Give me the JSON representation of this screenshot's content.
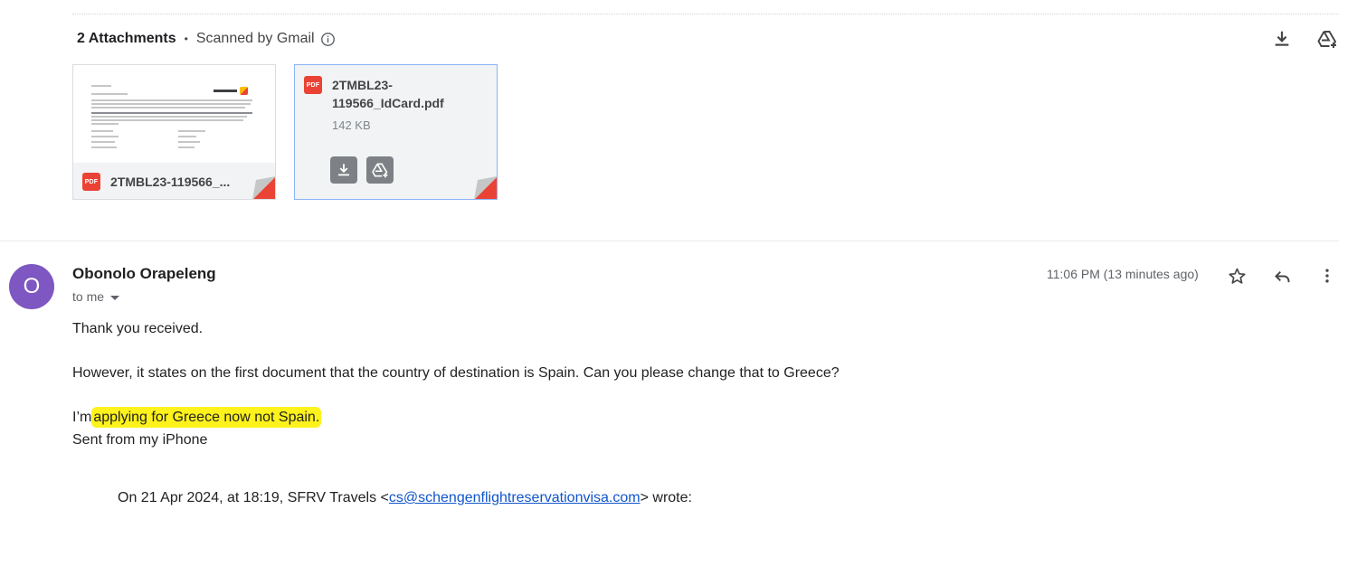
{
  "attachments": {
    "count_label": "2 Attachments",
    "separator": "•",
    "scanned_label": "Scanned by Gmail",
    "files": [
      {
        "name": "2TMBL23-119566_...",
        "type_badge": "PDF"
      },
      {
        "name": "2TMBL23-119566_IdCard.pdf",
        "size": "142 KB",
        "type_badge": "PDF"
      }
    ]
  },
  "message": {
    "avatar_initial": "O",
    "avatar_color": "#7e57c2",
    "sender": "Obonolo Orapeleng",
    "recipient": "to me",
    "timestamp": "11:06 PM (13 minutes ago)",
    "lines": {
      "l1": "Thank you received.",
      "l2": "However, it states on the first document that the country of destination is Spain. Can you please change that to Greece?",
      "l3_prefix": "I’m",
      "l3_highlight": "applying for Greece now not Spain.",
      "l4": "Sent from my iPhone"
    },
    "quote": {
      "prefix": "On 21 Apr 2024, at 18:19, SFRV Travels <",
      "email": "cs@schengenflightreservationvisa.com",
      "suffix": "> wrote:"
    }
  },
  "icons": {
    "info": "info-icon",
    "download_all": "download-icon",
    "add_to_drive": "add-to-drive-icon",
    "star": "star-icon",
    "reply": "reply-icon",
    "more": "more-vert-icon"
  },
  "colors": {
    "highlight": "#fdf21c",
    "link": "#1155cc",
    "pdf_red": "#ea4335"
  }
}
